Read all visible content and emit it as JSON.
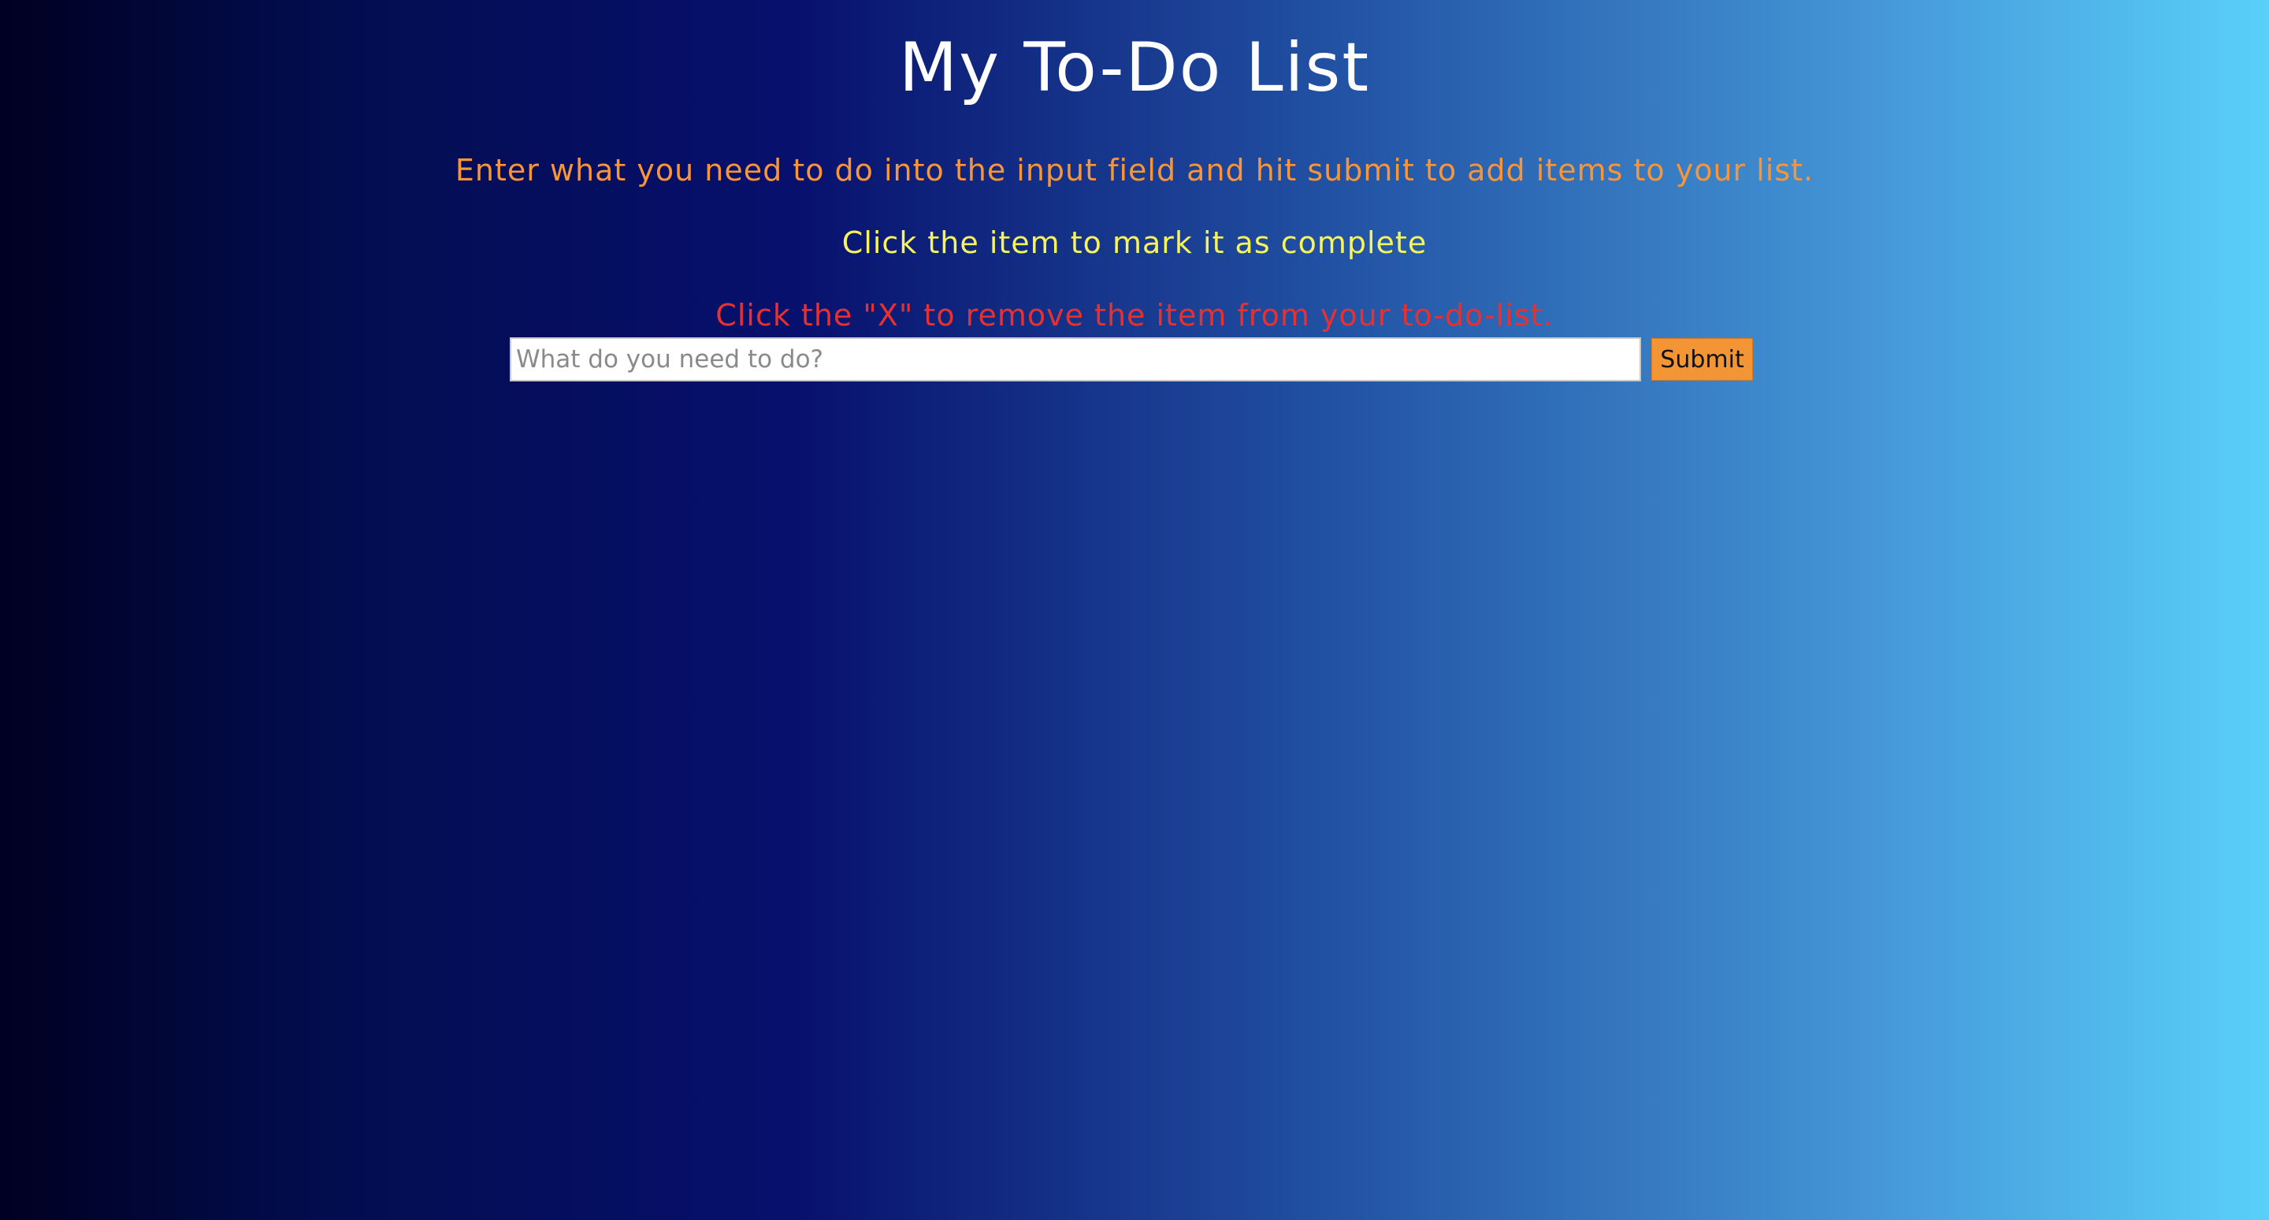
{
  "header": {
    "title": "My To-Do List"
  },
  "instructions": {
    "enter": "Enter what you need to do into the input field and hit submit to add items to your list.",
    "complete": "Click the item to mark it as complete",
    "remove": "Click the \"X\" to remove the item from your to-do-list."
  },
  "form": {
    "input_value": "",
    "input_placeholder": "What do you need to do?",
    "submit_label": "Submit"
  },
  "colors": {
    "title": "#ffffff",
    "enter_text": "#f7953a",
    "complete_text": "#f7f35a",
    "remove_text": "#e83030",
    "submit_button": "#f39535",
    "gradient_start": "#000021",
    "gradient_mid": "#07106d",
    "gradient_end": "#59d0fa"
  },
  "todo_items": []
}
